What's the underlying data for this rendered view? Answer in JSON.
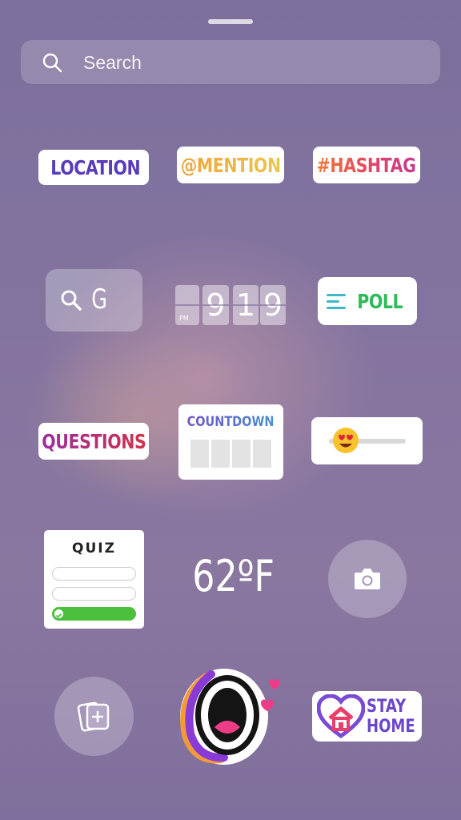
{
  "search": {
    "placeholder": "Search"
  },
  "stickers": {
    "location": "LOCATION",
    "mention": "@MENTION",
    "hashtag": "#HASHTAG",
    "gif": "G",
    "clock": {
      "hour": "9",
      "minute1": "1",
      "minute2": "9",
      "meridiem": "PM"
    },
    "poll": "POLL",
    "questions": "QUESTIONS",
    "countdown": "COUNTDOWN",
    "quiz": "QUIZ",
    "temperature": "62ºF",
    "stay_home": [
      "STAY",
      "HOME"
    ]
  },
  "emoji_slider": {
    "value": 0.0
  },
  "icons": [
    "search-icon",
    "location-pin-icon",
    "gif-search-icon",
    "camera-icon",
    "add-media-icon",
    "heart-home-icon",
    "heart-eyes-emoji-icon"
  ],
  "colors": {
    "background": "#82739f",
    "location": "#5a3bb8",
    "poll_text": "#2bbd5a",
    "quiz_correct": "#4cbf3d"
  }
}
